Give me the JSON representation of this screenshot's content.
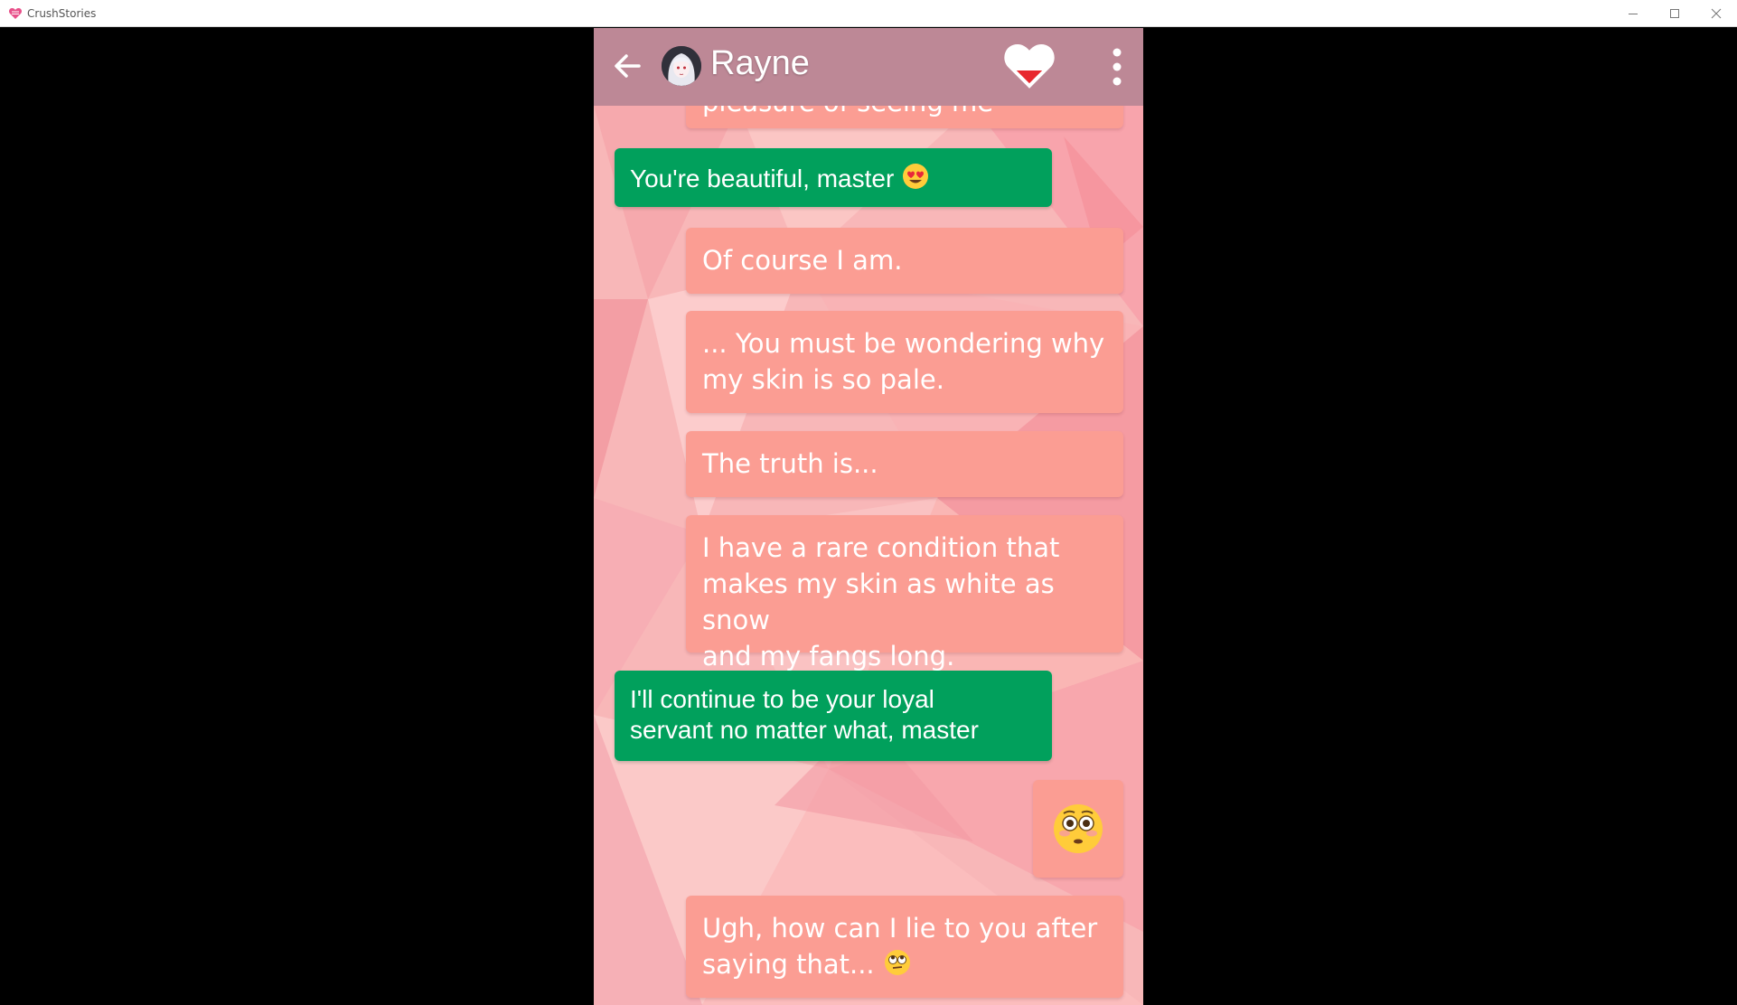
{
  "window": {
    "title": "CrushStories",
    "controls": [
      "minimize-icon",
      "maximize-icon",
      "close-icon"
    ]
  },
  "header": {
    "contact_name": "Rayne",
    "icons": [
      "back-arrow-icon",
      "avatar",
      "heart-meter-icon",
      "more-vertical-icon"
    ],
    "colors": {
      "bar": "#bd8896",
      "heart_fill": "#e8282e"
    }
  },
  "messages": [
    {
      "sender": "them",
      "text": "pleasure of seeing me",
      "partial": true
    },
    {
      "sender": "me",
      "text": "You're beautiful, master",
      "emoji": "heart-eyes-emoji"
    },
    {
      "sender": "them",
      "text": "Of course I am."
    },
    {
      "sender": "them",
      "lines": [
        "... You must be wondering why",
        "my skin is so pale."
      ]
    },
    {
      "sender": "them",
      "text": "The truth is..."
    },
    {
      "sender": "them",
      "lines": [
        "I have a rare condition that",
        "makes my skin as white as snow",
        "and my fangs long."
      ]
    },
    {
      "sender": "me",
      "lines": [
        "I'll continue to be your loyal",
        "servant no matter what, master"
      ]
    },
    {
      "sender": "them",
      "emoji": "flushed-face-emoji"
    },
    {
      "sender": "them",
      "lines": [
        "Ugh, how can I lie to you after",
        "saying that..."
      ],
      "emoji": "rolling-eyes-emoji"
    }
  ],
  "colors": {
    "their_bubble": "#fb9d93",
    "my_bubble": "#01a05c",
    "background": "#f7b4b4"
  }
}
